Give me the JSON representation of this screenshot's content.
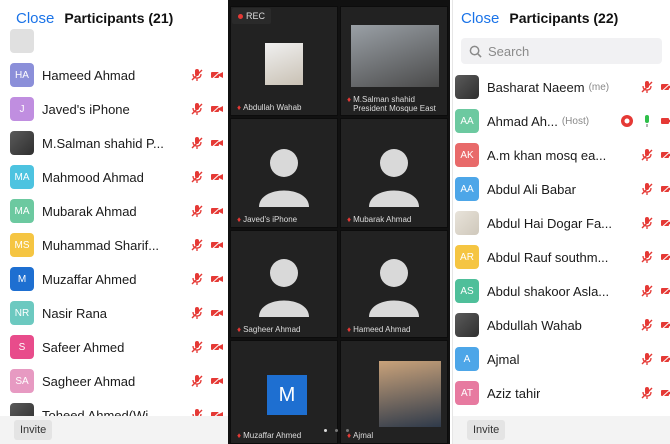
{
  "left_panel": {
    "close": "Close",
    "title": "Participants (21)",
    "invite": "Invite",
    "participants": [
      {
        "initials": "",
        "name": "",
        "color": "#e0e0e0",
        "photo": "none"
      },
      {
        "initials": "HA",
        "name": "Hameed Ahmad",
        "color": "#8b8fd9"
      },
      {
        "initials": "J",
        "name": "Javed's iPhone",
        "color": "#c08ee0"
      },
      {
        "initials": "",
        "name": "M.Salman shahid P...",
        "color": "#444444",
        "photo": "dark"
      },
      {
        "initials": "MA",
        "name": "Mahmood Ahmad",
        "color": "#4dc3e0"
      },
      {
        "initials": "MA",
        "name": "Mubarak Ahmad",
        "color": "#6cc9a0"
      },
      {
        "initials": "MS",
        "name": "Muhammad Sharif...",
        "color": "#f5c542"
      },
      {
        "initials": "M",
        "name": "Muzaffar Ahmed",
        "color": "#1e6fd1"
      },
      {
        "initials": "NR",
        "name": "Nasir Rana",
        "color": "#6cc9c0"
      },
      {
        "initials": "S",
        "name": "Safeer Ahmed",
        "color": "#e84c8b"
      },
      {
        "initials": "SA",
        "name": "Sagheer Ahmad",
        "color": "#e79ac2"
      },
      {
        "initials": "",
        "name": "Toheed Ahmed(Wi...",
        "color": "#444444",
        "photo": "dark"
      }
    ]
  },
  "gallery": {
    "rec": "REC",
    "tiles": [
      {
        "label": "Abdullah Wahab"
      },
      {
        "label": "M.Salman shahid President Mosque East"
      },
      {
        "label": "Javed's iPhone"
      },
      {
        "label": "Mubarak Ahmad"
      },
      {
        "label": "Sagheer Ahmad"
      },
      {
        "label": "Hameed Ahmad"
      },
      {
        "label": "Muzaffar Ahmed",
        "initial": "M"
      },
      {
        "label": "Ajmal"
      }
    ]
  },
  "right_panel": {
    "close": "Close",
    "title": "Participants (22)",
    "search_placeholder": "Search",
    "invite": "Invite",
    "participants": [
      {
        "initials": "",
        "name": "Basharat Naeem",
        "tag": "(me)",
        "color": "#444444",
        "photo": "dark"
      },
      {
        "initials": "AA",
        "name": "Ahmad Ah...",
        "tag": "(Host)",
        "color": "#6cc9a0",
        "host": true
      },
      {
        "initials": "AK",
        "name": "A.m khan  mosq ea...",
        "color": "#e86a6a"
      },
      {
        "initials": "AA",
        "name": "Abdul Ali Babar",
        "color": "#4da6e8"
      },
      {
        "initials": "",
        "name": "Abdul Hai Dogar Fa...",
        "color": "#e8e3da",
        "photo": "light"
      },
      {
        "initials": "AR",
        "name": "Abdul Rauf southm...",
        "color": "#f5c542"
      },
      {
        "initials": "AS",
        "name": "Abdul shakoor Asla...",
        "color": "#4fbf9a"
      },
      {
        "initials": "",
        "name": "Abdullah Wahab",
        "color": "#444444",
        "photo": "dark"
      },
      {
        "initials": "A",
        "name": "Ajmal",
        "color": "#4da6e8"
      },
      {
        "initials": "AT",
        "name": "Aziz tahir",
        "color": "#e77aa0"
      }
    ]
  }
}
